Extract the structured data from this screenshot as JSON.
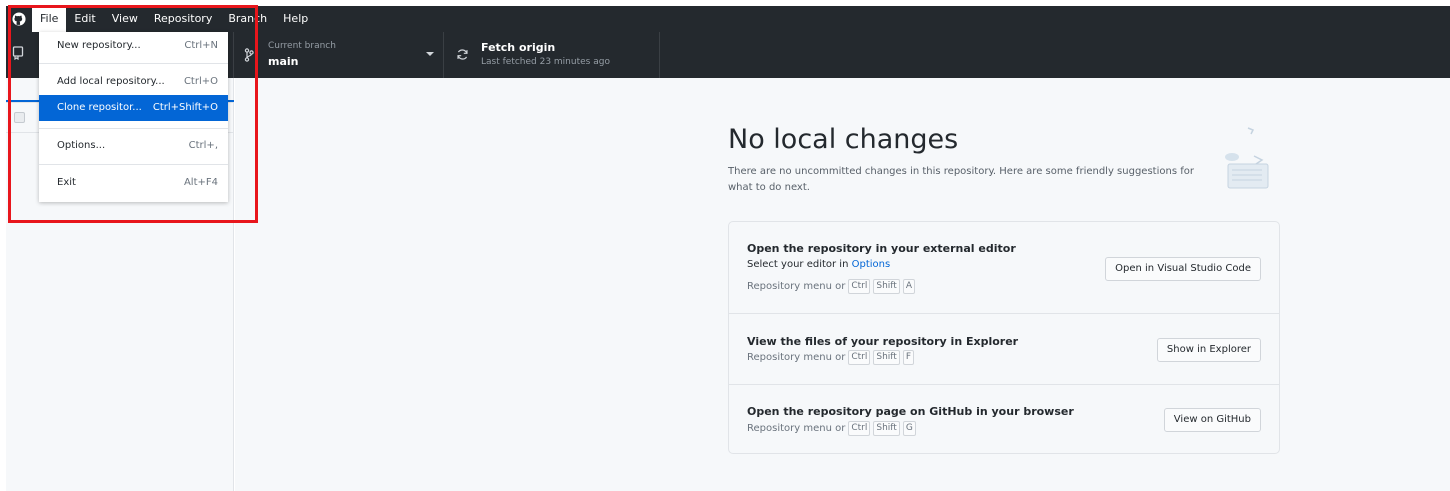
{
  "colors": {
    "menubar_bg": "#24292e",
    "accent": "#0366d6",
    "annotation": "#e8161c"
  },
  "menubar": {
    "logo_icon": "github-logo-icon",
    "items": [
      {
        "label": "File"
      },
      {
        "label": "Edit"
      },
      {
        "label": "View"
      },
      {
        "label": "Repository"
      },
      {
        "label": "Branch"
      },
      {
        "label": "Help"
      }
    ]
  },
  "file_menu": {
    "items": [
      {
        "label": "New repository...",
        "accelerator": "Ctrl+N"
      },
      {
        "label": "Add local repository...",
        "accelerator": "Ctrl+O"
      },
      {
        "label": "Clone repositor...",
        "accelerator": "Ctrl+Shift+O"
      },
      {
        "label": "Options...",
        "accelerator": "Ctrl+,"
      },
      {
        "label": "Exit",
        "accelerator": "Alt+F4"
      }
    ]
  },
  "toolbar": {
    "repo_icon": "repository-icon",
    "branch": {
      "label": "Current branch",
      "value": "main",
      "icon": "git-branch-icon"
    },
    "fetch": {
      "label": "Fetch origin",
      "sublabel": "Last fetched 23 minutes ago",
      "icon": "sync-icon"
    }
  },
  "main": {
    "title": "No local changes",
    "description": "There are no uncommitted changes in this repository. Here are some friendly suggestions for what to do next.",
    "actions": [
      {
        "title": "Open the repository in your external editor",
        "desc_prefix": "Select your editor in ",
        "desc_link": "Options",
        "hint_prefix": "Repository menu or",
        "keys": [
          "Ctrl",
          "Shift",
          "A"
        ],
        "button": "Open in Visual Studio Code"
      },
      {
        "title": "View the files of your repository in Explorer",
        "hint_prefix": "Repository menu or",
        "keys": [
          "Ctrl",
          "Shift",
          "F"
        ],
        "button": "Show in Explorer"
      },
      {
        "title": "Open the repository page on GitHub in your browser",
        "hint_prefix": "Repository menu or",
        "keys": [
          "Ctrl",
          "Shift",
          "G"
        ],
        "button": "View on GitHub"
      }
    ]
  }
}
